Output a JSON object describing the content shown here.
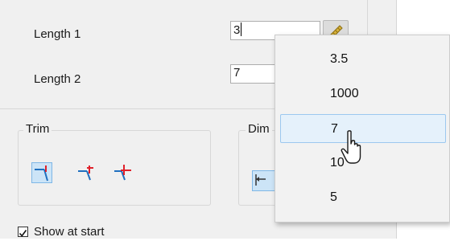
{
  "lengths": {
    "length1": {
      "label": "Length 1",
      "value": "3"
    },
    "length2": {
      "label": "Length 2",
      "value": "7"
    }
  },
  "trim": {
    "title": "Trim",
    "buttons": [
      "trim-corner-icon",
      "trim-extend-icon",
      "trim-cross-icon"
    ]
  },
  "dim": {
    "title": "Dim"
  },
  "show_at_start": {
    "label": "Show at start",
    "checked": true
  },
  "dropdown": {
    "items": [
      "3.5",
      "1000",
      "7",
      "10",
      "5"
    ],
    "highlighted": "7"
  },
  "colors": {
    "accent_red": "#e0202a",
    "accent_blue": "#1f6fbf",
    "highlight_bg": "#e5f1fb"
  }
}
